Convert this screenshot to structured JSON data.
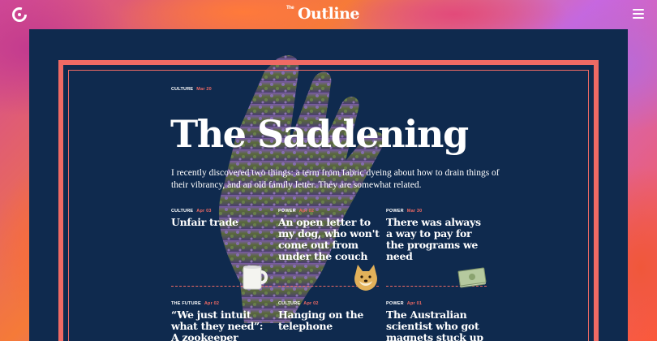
{
  "header": {
    "brand_small": "The",
    "brand": "Outline"
  },
  "feature": {
    "kicker": "CULTURE",
    "date": "Mar 20",
    "title": "The Saddening",
    "dek": "I recently discovered two things: a term from fabric dyeing about how to drain things of their vibrancy, and an old family letter. They are somewhat related."
  },
  "cards": [
    {
      "kicker": "CULTURE",
      "date": "Apr 03",
      "title": "Unfair trade"
    },
    {
      "kicker": "POWER",
      "date": "Apr 02",
      "title": "An open letter to my dog, who won't come out from under the couch"
    },
    {
      "kicker": "POWER",
      "date": "Mar 30",
      "title": "There was always a way to pay for the programs we need"
    },
    {
      "kicker": "THE FUTURE",
      "date": "Apr 02",
      "title": "“We just intuit what they need”: A zookeeper describes"
    },
    {
      "kicker": "CULTURE",
      "date": "Apr 02",
      "title": "Hanging on the telephone"
    },
    {
      "kicker": "POWER",
      "date": "Apr 01",
      "title": "The Australian scientist who got magnets stuck up his"
    }
  ],
  "icons": {
    "logo": "outline-circle-logo-icon",
    "menu": "hamburger-menu-icon",
    "mug": "mug-icon",
    "doge": "doge-dog-icon",
    "money": "money-stack-icon"
  },
  "colors": {
    "panel": "#0f2a4e",
    "accent": "#ef6a64",
    "text": "#ffffff"
  }
}
